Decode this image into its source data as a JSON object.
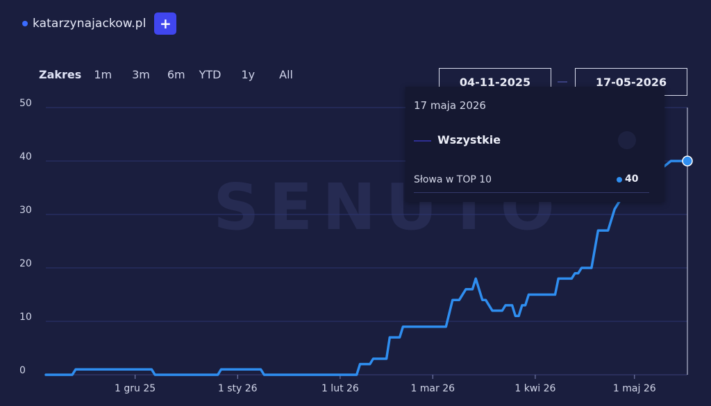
{
  "header": {
    "domain": "katarzynajackow.pl",
    "add_label": "+",
    "accent": "#4046ee"
  },
  "range": {
    "label": "Zakres",
    "options": [
      "1m",
      "3m",
      "6m",
      "YTD",
      "1y",
      "All"
    ]
  },
  "date_range": {
    "from": "04-11-2025",
    "to": "17-05-2026"
  },
  "watermark": "SENUTO",
  "tooltip": {
    "date": "17 maja 2026",
    "series": "Wszystkie",
    "metric": "Słowa w TOP 10",
    "value": "40"
  },
  "chart_data": {
    "type": "line",
    "title": "",
    "xlabel": "",
    "ylabel": "",
    "ylim": [
      0,
      50
    ],
    "y_ticks": [
      0,
      10,
      20,
      30,
      40,
      50
    ],
    "x_tick_labels": [
      "1 gru 25",
      "1 sty 26",
      "1 lut 26",
      "1 mar 26",
      "1 kwi 26",
      "1 maj 26"
    ],
    "x_tick_dates": [
      "2025-12-01",
      "2026-01-01",
      "2026-02-01",
      "2026-03-01",
      "2026-04-01",
      "2026-05-01"
    ],
    "x_range": [
      "2025-11-04",
      "2026-05-17"
    ],
    "grid": true,
    "line_color": "#2f8ef0",
    "series": [
      {
        "values": [
          [
            "2025-11-04",
            0
          ],
          [
            "2025-11-12",
            0
          ],
          [
            "2025-11-13",
            1
          ],
          [
            "2025-12-06",
            1
          ],
          [
            "2025-12-07",
            0
          ],
          [
            "2025-12-26",
            0
          ],
          [
            "2025-12-27",
            1
          ],
          [
            "2026-01-08",
            1
          ],
          [
            "2026-01-09",
            0
          ],
          [
            "2026-02-06",
            0
          ],
          [
            "2026-02-07",
            2
          ],
          [
            "2026-02-10",
            2
          ],
          [
            "2026-02-11",
            3
          ],
          [
            "2026-02-15",
            3
          ],
          [
            "2026-02-16",
            7
          ],
          [
            "2026-02-19",
            7
          ],
          [
            "2026-02-20",
            9
          ],
          [
            "2026-03-05",
            9
          ],
          [
            "2026-03-07",
            14
          ],
          [
            "2026-03-09",
            14
          ],
          [
            "2026-03-11",
            16
          ],
          [
            "2026-03-13",
            16
          ],
          [
            "2026-03-14",
            18
          ],
          [
            "2026-03-16",
            14
          ],
          [
            "2026-03-17",
            14
          ],
          [
            "2026-03-19",
            12
          ],
          [
            "2026-03-22",
            12
          ],
          [
            "2026-03-23",
            13
          ],
          [
            "2026-03-25",
            13
          ],
          [
            "2026-03-26",
            11
          ],
          [
            "2026-03-27",
            11
          ],
          [
            "2026-03-28",
            13
          ],
          [
            "2026-03-29",
            13
          ],
          [
            "2026-03-30",
            15
          ],
          [
            "2026-04-07",
            15
          ],
          [
            "2026-04-08",
            18
          ],
          [
            "2026-04-12",
            18
          ],
          [
            "2026-04-13",
            19
          ],
          [
            "2026-04-14",
            19
          ],
          [
            "2026-04-15",
            20
          ],
          [
            "2026-04-18",
            20
          ],
          [
            "2026-04-20",
            27
          ],
          [
            "2026-04-23",
            27
          ],
          [
            "2026-04-25",
            31
          ],
          [
            "2026-04-27",
            33
          ],
          [
            "2026-04-28",
            33
          ],
          [
            "2026-04-30",
            38
          ],
          [
            "2026-05-03",
            38
          ],
          [
            "2026-05-04",
            39
          ],
          [
            "2026-05-08",
            39
          ],
          [
            "2026-05-09",
            39
          ],
          [
            "2026-05-10",
            39
          ],
          [
            "2026-05-12",
            40
          ],
          [
            "2026-05-17",
            40
          ]
        ]
      }
    ]
  }
}
